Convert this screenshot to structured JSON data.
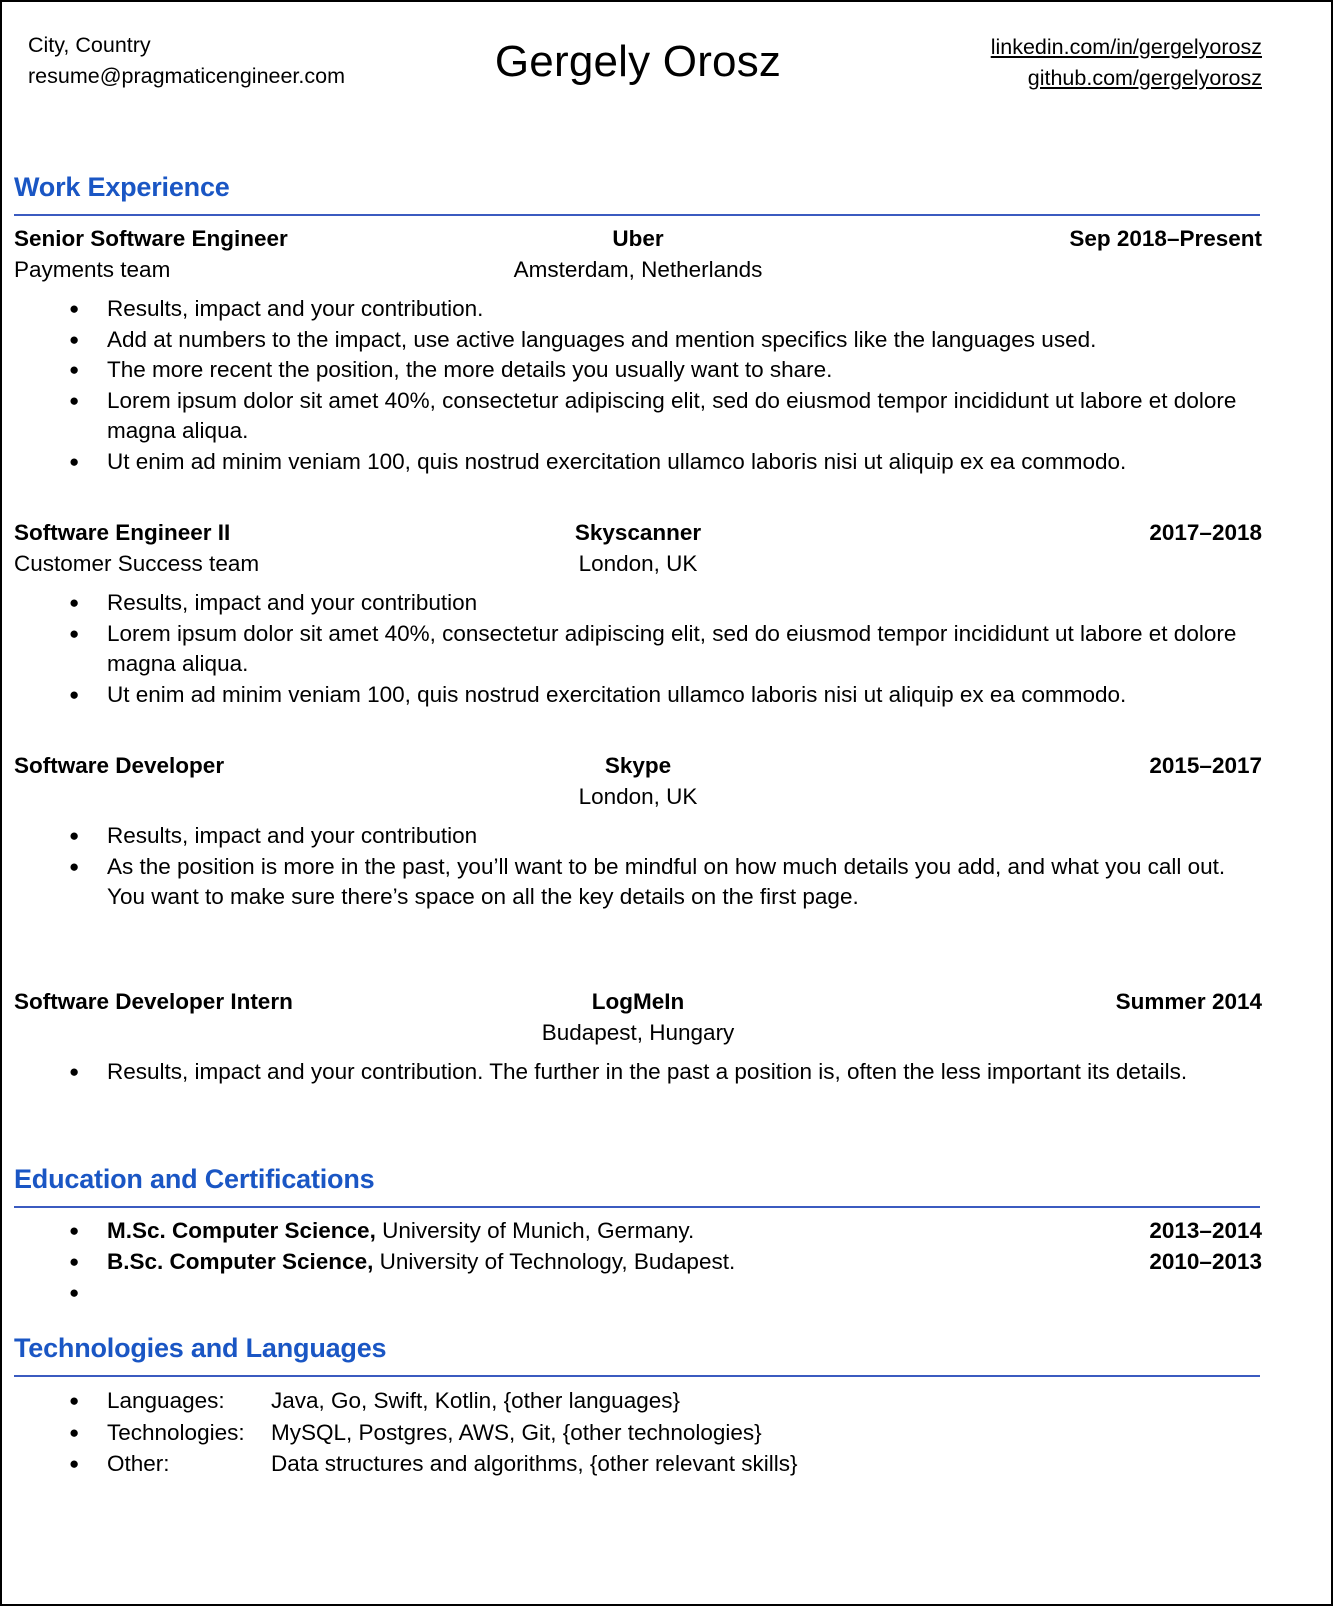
{
  "header": {
    "contact": {
      "location": "City, Country",
      "email": "resume@pragmaticengineer.com"
    },
    "name": "Gergely Orosz",
    "links": {
      "linkedin": "linkedin.com/in/gergelyorosz",
      "github": "github.com/gergelyorosz"
    }
  },
  "colors": {
    "heading_blue": "#1a56c4",
    "rule_blue": "#3b5bc0",
    "text_black": "#000000",
    "page_background": "#ffffff"
  },
  "sections": {
    "work": {
      "title": "Work Experience",
      "jobs": [
        {
          "title": "Senior Software Engineer",
          "company": "Uber",
          "dates": "Sep 2018–Present",
          "team": "Payments team",
          "location": "Amsterdam, Netherlands",
          "bullets": [
            "Results, impact and your contribution.",
            "Add at numbers to the impact, use active languages and mention specifics like the languages used.",
            "The more recent the position, the more details you usually want to share.",
            "Lorem ipsum dolor sit amet 40%, consectetur adipiscing elit, sed do eiusmod tempor incididunt ut labore et dolore magna aliqua.",
            "Ut enim ad minim veniam 100, quis nostrud exercitation ullamco laboris nisi ut aliquip ex ea commodo."
          ]
        },
        {
          "title": "Software Engineer II",
          "company": "Skyscanner",
          "dates": "2017–2018",
          "team": "Customer Success team",
          "location": "London, UK",
          "bullets": [
            "Results, impact and your contribution",
            "Lorem ipsum dolor sit amet 40%, consectetur adipiscing elit, sed do eiusmod tempor incididunt ut labore et dolore magna aliqua.",
            "Ut enim ad minim veniam 100, quis nostrud exercitation ullamco laboris nisi ut aliquip ex ea commodo."
          ]
        },
        {
          "title": "Software Developer",
          "company": "Skype",
          "dates": "2015–2017",
          "team": "",
          "location": "London, UK",
          "bullets": [
            "Results, impact and your contribution",
            "As the position is more in the past, you’ll want to be mindful on how much details you add, and what you call out. You want to make sure there’s space on all the key details on the first page."
          ]
        },
        {
          "title": "Software Developer Intern",
          "company": "LogMeIn",
          "dates": "Summer 2014",
          "team": "",
          "location": "Budapest, Hungary",
          "bullets": [
            "Results, impact and your contribution. The further in the past a position is, often the less important its details."
          ]
        }
      ]
    },
    "education": {
      "title": "Education and Certifications",
      "items": [
        {
          "degree": "M.Sc. Computer Science,",
          "institution": " University of Munich, Germany.",
          "years": "2013–2014"
        },
        {
          "degree": "B.Sc. Computer Science,",
          "institution": " University of Technology, Budapest.",
          "years": "2010–2013"
        },
        {
          "degree": "",
          "institution": "",
          "years": ""
        }
      ]
    },
    "skills": {
      "title": "Technologies and Languages",
      "rows": [
        {
          "label": "Languages:",
          "value": "Java, Go, Swift, Kotlin, {other languages}"
        },
        {
          "label": "Technologies:",
          "value": "MySQL, Postgres, AWS, Git, {other technologies}"
        },
        {
          "label": "Other:",
          "value": "Data structures and algorithms, {other relevant skills}"
        }
      ]
    }
  },
  "icons": {
    "bullet": "●"
  }
}
